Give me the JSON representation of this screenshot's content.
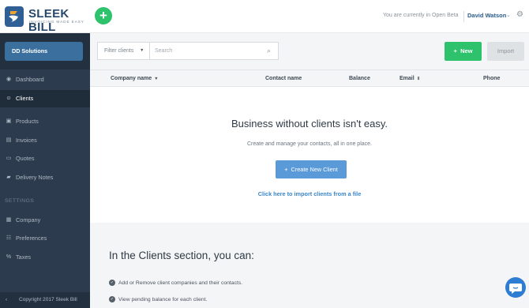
{
  "topbar": {
    "logo_name": "SLEEK BILL",
    "logo_tagline": "INVOICING MADE EASY",
    "beta_text": "You are currently in Open Beta",
    "user_name": "David Watson"
  },
  "sidebar": {
    "company": "DD Solutions",
    "items": [
      {
        "label": "Dashboard",
        "icon": "eye-icon"
      },
      {
        "label": "Clients",
        "icon": "user-icon"
      },
      {
        "label": "Products",
        "icon": "box-icon"
      },
      {
        "label": "Invoices",
        "icon": "document-icon"
      },
      {
        "label": "Quotes",
        "icon": "quote-icon"
      },
      {
        "label": "Delivery Notes",
        "icon": "truck-icon"
      }
    ],
    "settings_label": "SETTINGS",
    "settings_items": [
      {
        "label": "Company",
        "icon": "building-icon"
      },
      {
        "label": "Preferences",
        "icon": "sliders-icon"
      },
      {
        "label": "Taxes",
        "icon": "percent-icon"
      }
    ],
    "footer": "Copyright 2017 Sleek Bill"
  },
  "toolbar": {
    "filter_label": "Filter clients",
    "search_placeholder": "Search",
    "new_label": "New",
    "import_label": "Import"
  },
  "table": {
    "columns": [
      "Company name",
      "Contact name",
      "Balance",
      "Email",
      "Phone"
    ]
  },
  "empty_state": {
    "title": "Business without clients isn't easy.",
    "subtitle": "Create and manage your contacts, all in one place.",
    "create_label": "Create New Client",
    "import_link": "Click here to import clients from a file"
  },
  "info": {
    "title": "In the Clients section, you can:",
    "items": [
      "Add or Remove client companies and their contacts.",
      "View pending balance for each client."
    ]
  },
  "colors": {
    "brand_green": "#2dc26b",
    "sidebar_bg": "#2c3b4d",
    "accent_blue": "#5b9ad8"
  }
}
